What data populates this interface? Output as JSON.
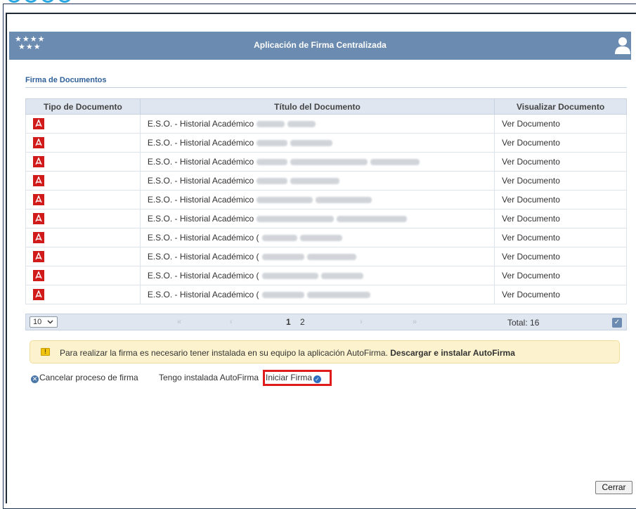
{
  "app": {
    "title": "Aplicación de Firma Centralizada",
    "stars_row1": "★★★★",
    "stars_row2": "★★★"
  },
  "section": {
    "title": "Firma de Documentos"
  },
  "table": {
    "headers": [
      "Tipo de Documento",
      "Título del Documento",
      "Visualizar Documento"
    ],
    "rows": [
      {
        "title": "E.S.O. - Historial Académico",
        "link": "Ver Documento"
      },
      {
        "title": "E.S.O. - Historial Académico",
        "link": "Ver Documento"
      },
      {
        "title": "E.S.O. - Historial Académico",
        "link": "Ver Documento"
      },
      {
        "title": "E.S.O. - Historial Académico",
        "link": "Ver Documento"
      },
      {
        "title": "E.S.O. - Historial Académico",
        "link": "Ver Documento"
      },
      {
        "title": "E.S.O. - Historial Académico",
        "link": "Ver Documento"
      },
      {
        "title": "E.S.O. - Historial Académico (",
        "link": "Ver Documento"
      },
      {
        "title": "E.S.O. - Historial Académico (",
        "link": "Ver Documento"
      },
      {
        "title": "E.S.O. - Historial Académico (",
        "link": "Ver Documento"
      },
      {
        "title": "E.S.O. - Historial Académico (",
        "link": "Ver Documento"
      }
    ]
  },
  "pager": {
    "page_size": "10",
    "first": "«",
    "prev": "‹",
    "next": "›",
    "last": "»",
    "page1": "1",
    "page2": "2",
    "total": "Total: 16"
  },
  "notice": {
    "text": "Para realizar la firma es necesario tener instalada en su equipo la aplicación AutoFirma.",
    "link": "Descargar e instalar AutoFirma"
  },
  "actions": {
    "cancel": "Cancelar proceso de firma",
    "installed": "Tengo instalada AutoFirma",
    "start": "Iniciar Firma"
  },
  "footer": {
    "close": "Cerrar"
  },
  "colors": {
    "header": "#6b8bb0",
    "highlight": "#e01b1b",
    "pdf_red": "#d11a1a"
  }
}
